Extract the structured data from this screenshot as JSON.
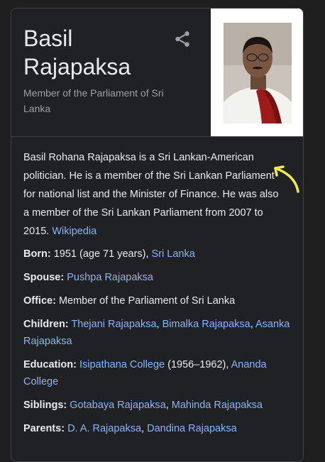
{
  "entity": {
    "name_line1": "Basil",
    "name_line2": "Rajapaksa",
    "subtitle": "Member of the Parliament of Sri Lanka",
    "share_icon": "share-icon"
  },
  "description": {
    "text": "Basil Rohana Rajapaksa is a Sri Lankan-American politician. He is a member of the Sri Lankan Parliament for national list and the Minister of Finance. He was also a member of the Sri Lankan Parliament from 2007 to 2015.",
    "source_link": "Wikipedia"
  },
  "facts": {
    "born_label": "Born:",
    "born_value": "1951 (age 71 years),",
    "born_place": "Sri Lanka",
    "spouse_label": "Spouse:",
    "spouse_value": "Pushpa Rajapaksa",
    "office_label": "Office:",
    "office_value": "Member of the Parliament of Sri Lanka",
    "children_label": "Children:",
    "children": [
      "Thejani Rajapaksa",
      "Bimalka Rajapaksa",
      "Asanka Rajapaksa"
    ],
    "education_label": "Education:",
    "education_1": "Isipathana College",
    "education_1_years": "(1956–1962),",
    "education_2": "Ananda College",
    "siblings_label": "Siblings:",
    "siblings": [
      "Gotabaya Rajapaksa",
      "Mahinda Rajapaksa"
    ],
    "parents_label": "Parents:",
    "parents": [
      "D. A. Rajapaksa",
      "Dandina Rajapaksa"
    ]
  },
  "colors": {
    "link": "#8ab4f8",
    "annotation_arrow": "#f5e94a"
  }
}
